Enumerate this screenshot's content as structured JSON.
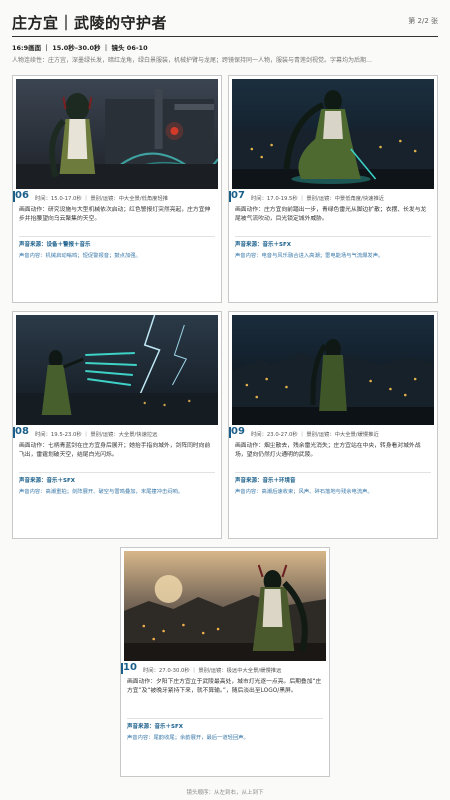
{
  "header": {
    "title": "庄方宜｜武陵的守护者",
    "page_indicator": "第 2/2 张"
  },
  "meta": "16:9画面 ｜ 15.0秒–30.0秒 ｜ 镜头 06-10",
  "continuity": "人物连续性：庄方宜，深墨绿长发，暗红龙角，绿白景服装，机械护臂与龙尾；跨镜保持同一人物，服装与青莲剑视觉。字幕均为后期…",
  "shots": [
    {
      "num": "06",
      "time": "时间：15.0-17.0秒 ｜ 景别/运镜：中大全景/低角度轻推",
      "action": "画面动作：研究设施与大型机械依次启动；红色警报灯突然亮起，庄方宜伸步并抬腰望向乌云聚集的天空。",
      "sound": "声音来源：设备＋警报＋音乐",
      "sound_content": "声音内容：机械启动嗡鸣；短促警报音；鼓点加强。",
      "palette": "palette-a"
    },
    {
      "num": "07",
      "time": "时间：17.0-19.5秒 ｜ 景别/运镜：中景低角度/快速推近",
      "action": "画面动作：庄方宜向前踏出一步，青绿色雷光从脚边扩散；衣摆、长发与龙尾被气流吹动，目光锁定城外威胁。",
      "sound": "声音来源：音乐＋SFX",
      "sound_content": "声音内容：电音与风乐融合进入高潮；雷电能场与气流爆发声。",
      "palette": "palette-b"
    },
    {
      "num": "08",
      "time": "时间：19.5-23.0秒 ｜ 景别/运镜：大全景/快速拉远",
      "action": "画面动作：七柄青蓝剑在庄方宜身后展开；她抬手指向城外，剑阵同时向前飞出，雷霆划破天空，结尾白光闪烁。",
      "sound": "声音来源：音乐＋SFX",
      "sound_content": "声音内容：高潮重拍；剑阵展开、破空与雷鸣叠加，末尾撞冲击闷响。",
      "palette": "palette-c"
    },
    {
      "num": "09",
      "time": "时间：23.0-27.0秒 ｜ 景别/运镜：中大全景/缓慢推近",
      "action": "画面动作：烟尘散去，残余雷光消失；庄方宜站在中央，转身看对城外战场，望向仍然灯火通明的武陵。",
      "sound": "声音来源：音乐＋环境音",
      "sound_content": "声音内容：高潮后速收束；风声、碎石落地与残余电流声。",
      "palette": "palette-d"
    },
    {
      "num": "10",
      "time": "时间：27.0-30.0秒 ｜ 景别/运镜：极远中大全景/缓慢推远",
      "action": "画面动作：夕阳下庄方宜立于武陵最高处，城市灯光逐一点亮。后期叠加“庄方宜”及“被晚牙紧持下来，就不算输。”，随后淡出至LOGO/黑屏。",
      "sound": "声音来源：音乐＋SFX",
      "sound_content": "声音内容：尾韵收尾；余韵展开，最后一道轻回声。",
      "palette": "palette-e"
    }
  ],
  "footer": "镜头顺序：从左到右，从上到下"
}
